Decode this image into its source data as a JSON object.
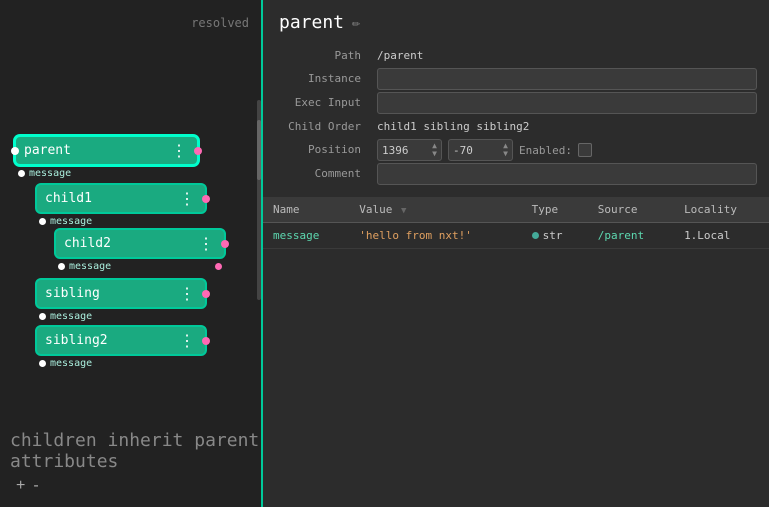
{
  "left": {
    "resolved_label": "resolved",
    "nodes": [
      {
        "id": "parent",
        "label": "parent",
        "depth": 0,
        "port": "message",
        "selected": true
      },
      {
        "id": "child1",
        "label": "child1",
        "depth": 1,
        "port": "message"
      },
      {
        "id": "child2",
        "label": "child2",
        "depth": 2,
        "port": "message"
      },
      {
        "id": "sibling",
        "label": "sibling",
        "depth": 1,
        "port": "message"
      },
      {
        "id": "sibling2",
        "label": "sibling2",
        "depth": 1,
        "port": "message"
      }
    ],
    "bottom_text": "children inherit parent attributes",
    "add_btn": "+",
    "remove_btn": "-"
  },
  "right": {
    "title": "parent",
    "edit_icon": "✏",
    "properties": {
      "path_label": "Path",
      "path_value": "/parent",
      "instance_label": "Instance",
      "instance_value": "",
      "exec_input_label": "Exec Input",
      "exec_input_value": "",
      "child_order_label": "Child Order",
      "child_order_value": "child1 sibling sibling2",
      "position_label": "Position",
      "position_x": "1396",
      "position_y": "-70",
      "enabled_label": "Enabled:",
      "comment_label": "Comment",
      "comment_value": ""
    },
    "table": {
      "columns": [
        {
          "id": "name",
          "label": "Name"
        },
        {
          "id": "value",
          "label": "Value"
        },
        {
          "id": "type",
          "label": "Type"
        },
        {
          "id": "source",
          "label": "Source"
        },
        {
          "id": "locality",
          "label": "Locality"
        }
      ],
      "rows": [
        {
          "name": "message",
          "value": "'hello from nxt!'",
          "type": "str",
          "source": "/parent",
          "locality": "1.Local"
        }
      ]
    }
  }
}
